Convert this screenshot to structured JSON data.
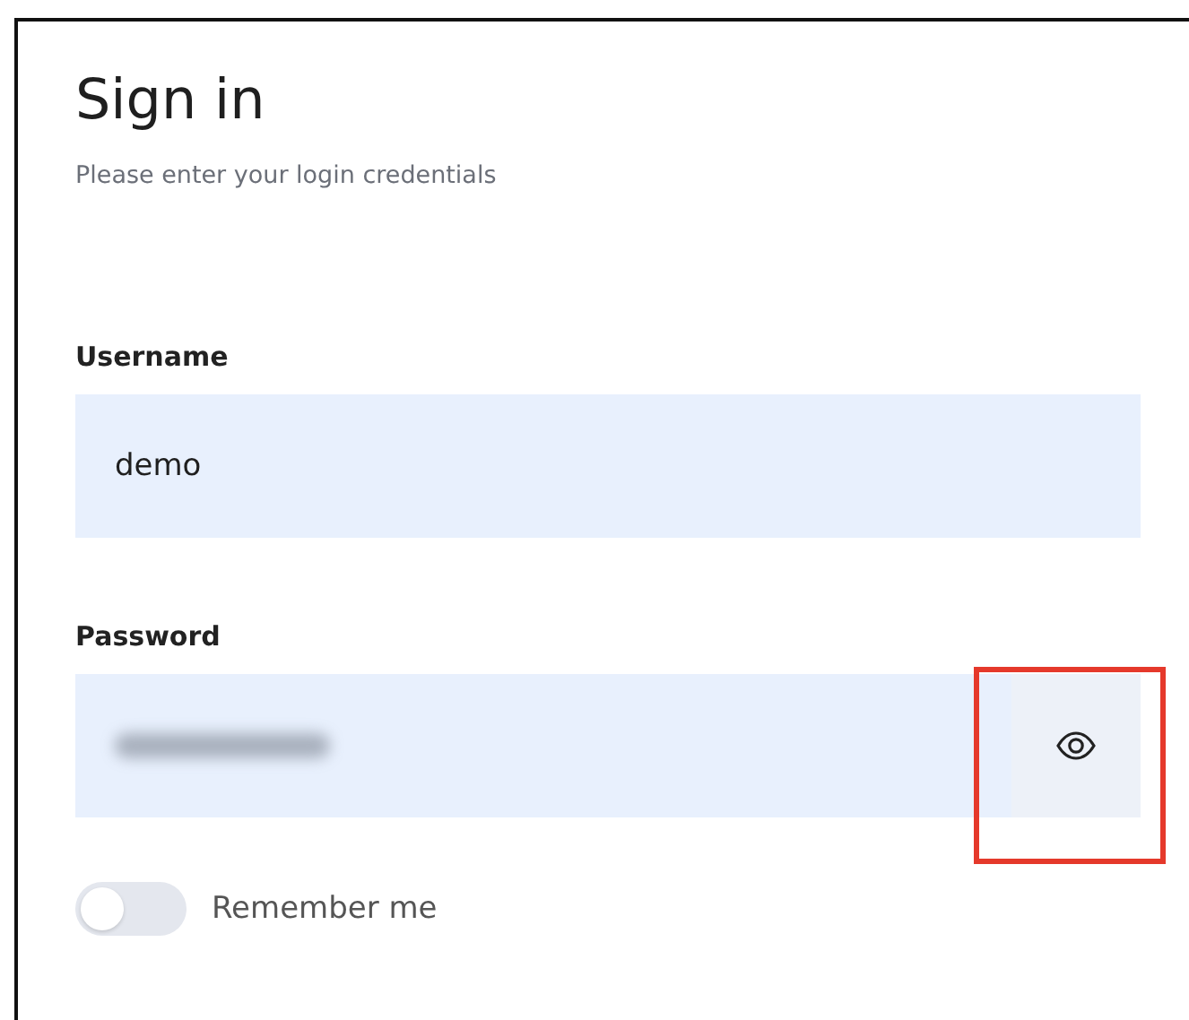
{
  "title": "Sign in",
  "subtitle": "Please enter your login credentials",
  "fields": [
    {
      "kind": "text",
      "label": "Username",
      "value": "demo"
    },
    {
      "kind": "password",
      "label": "Password",
      "reveal_button": {
        "highlighted": true
      }
    }
  ],
  "remember": {
    "label": "Remember me",
    "on": false
  }
}
